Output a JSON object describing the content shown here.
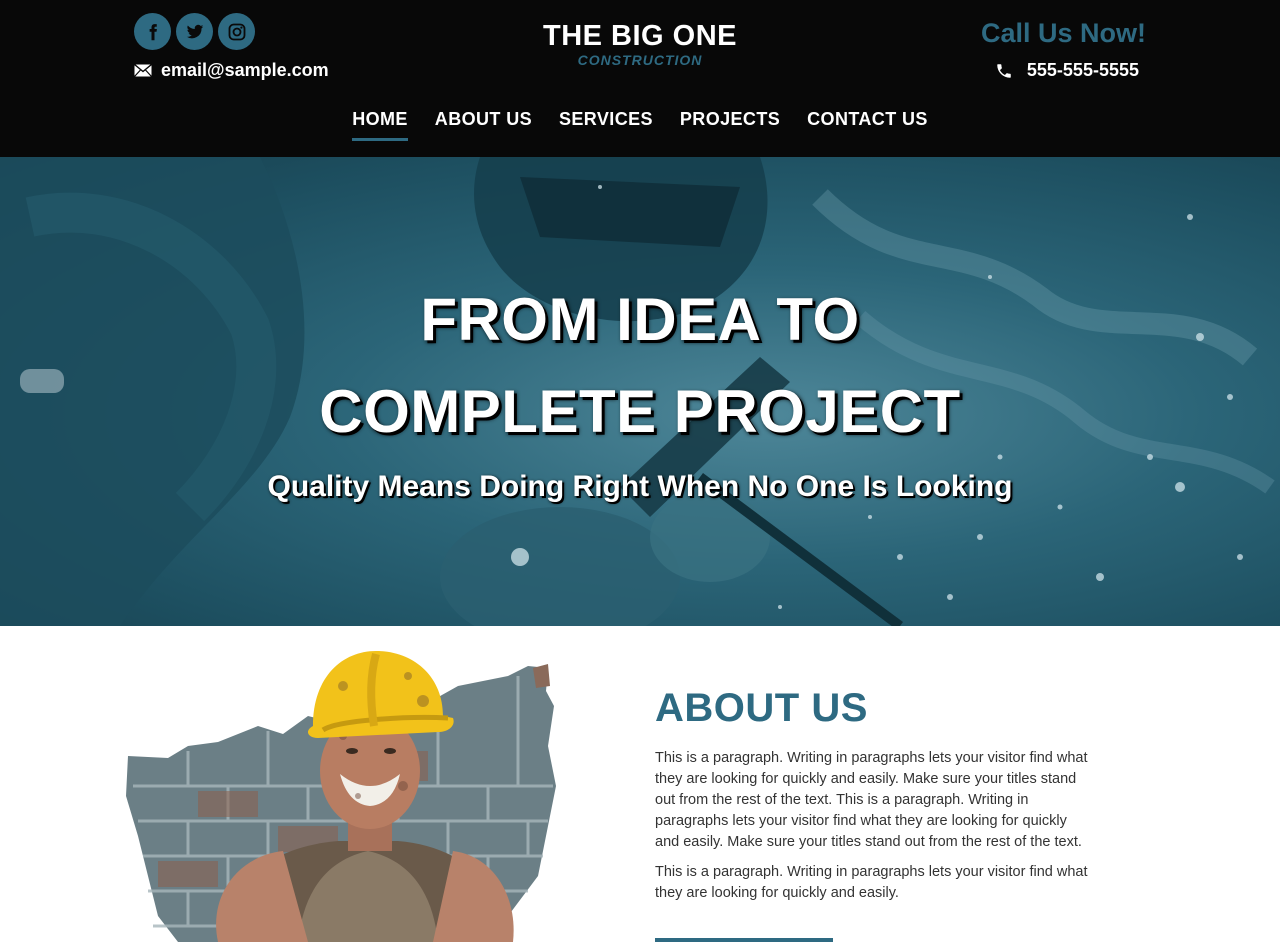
{
  "header": {
    "socials": [
      {
        "icon": "facebook-icon"
      },
      {
        "icon": "twitter-icon"
      },
      {
        "icon": "instagram-icon"
      }
    ],
    "email": "email@sample.com",
    "logo_title": "THE BIG ONE",
    "logo_subtitle": "CONSTRUCTION",
    "call_label": "Call Us Now!",
    "phone": "555-555-5555",
    "nav": [
      {
        "label": "HOME",
        "active": true
      },
      {
        "label": "ABOUT US"
      },
      {
        "label": "SERVICES"
      },
      {
        "label": "PROJECTS"
      },
      {
        "label": "CONTACT US"
      }
    ]
  },
  "hero": {
    "line1": "FROM IDEA TO",
    "line2": "COMPLETE PROJECT",
    "tagline": "Quality Means Doing Right When No One Is Looking"
  },
  "about": {
    "title": "ABOUT US",
    "paragraph1": "This is a paragraph. Writing in paragraphs lets your visitor find what they are looking for quickly and easily. Make sure your titles stand out from the rest of the text. This is a paragraph. Writing in paragraphs lets your visitor find what they are looking for quickly and easily. Make sure your titles stand out from the rest of the text.",
    "paragraph2": "This is a paragraph. Writing in paragraphs lets your visitor find what they are looking for quickly and easily."
  },
  "colors": {
    "accent": "#2e6a82",
    "header_bg": "#080808",
    "text": "#333333"
  }
}
